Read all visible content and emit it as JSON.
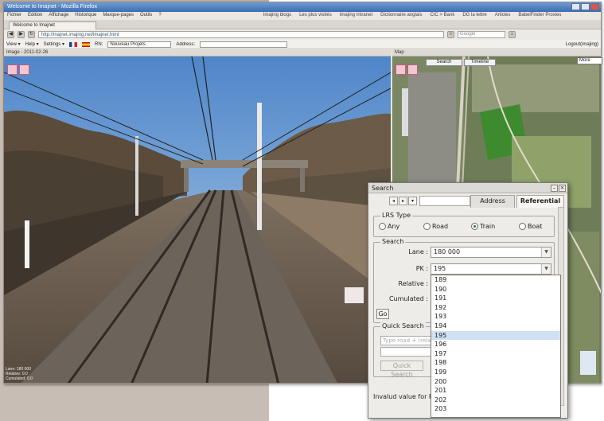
{
  "browser": {
    "window_title": "Welcome to Imajnet - Mozilla Firefox",
    "menu": [
      "Fichier",
      "Édition",
      "Affichage",
      "Historique",
      "Marque-pages",
      "Outils",
      "?"
    ],
    "bookmarks": [
      "Imajing blogs",
      "Les plus visités",
      "Imajing Intranet",
      "Dictionnaire anglais",
      "CIC > Bank",
      "DG la lettre",
      "Articles",
      "BabelFinder Proxies"
    ],
    "tab_title": "Welcome to Imajnet",
    "url": "http://inajnet.imajing.net/imajnet.html",
    "search_placeholder": "Google"
  },
  "app_toolbar": {
    "view": "View",
    "help": "Help",
    "settings": "Settings",
    "project_label": "RN:",
    "project_value": "Nouveau Projets",
    "address_label": "Address:",
    "logout": "Logout(imajing)"
  },
  "image_panel": {
    "header": "Image - 2011-02-26",
    "footer_lines": [
      "Lane: 180 000",
      "Relative: 0.0",
      "Cumulated: 0.0"
    ]
  },
  "map_panel": {
    "header": "Map",
    "search_button": "Search",
    "timeline_button": "Timeline",
    "map_type": "More"
  },
  "search_dialog": {
    "title": "Search",
    "tabs": [
      "Address",
      "Referential"
    ],
    "lrs_type_legend": "LRS Type",
    "lrs_options": [
      {
        "label": "Any",
        "checked": false
      },
      {
        "label": "Road",
        "checked": false
      },
      {
        "label": "Train",
        "checked": true
      },
      {
        "label": "Boat",
        "checked": false
      }
    ],
    "search_legend": "Search",
    "lane_label": "Lane :",
    "lane_value": "180 000",
    "pk_label": "PK :",
    "pk_value": "195",
    "relative_label": "Relative :",
    "cumulated_label": "Cumulated :",
    "go_button": "Go",
    "quick_search_legend": "Quick Search",
    "quick_search_placeholder": "Type road + (relative)",
    "quick_search_button": "Quick Search",
    "error_message": "Invalud value for Rela"
  },
  "pk_dropdown": {
    "options": [
      "189",
      "190",
      "191",
      "192",
      "193",
      "194",
      "195",
      "196",
      "197",
      "198",
      "199",
      "200",
      "201",
      "202",
      "203"
    ],
    "selected": "195"
  }
}
